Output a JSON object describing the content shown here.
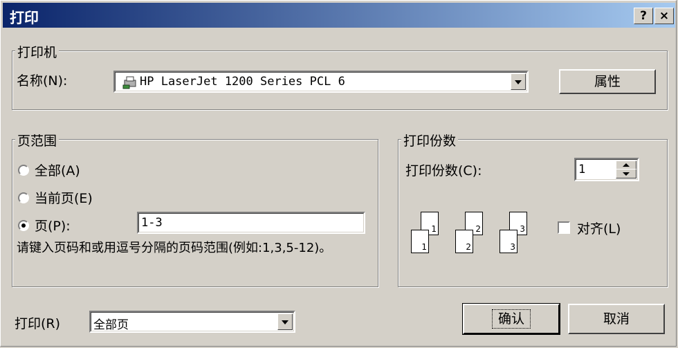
{
  "window": {
    "title": "打印",
    "help_btn": "?",
    "close_btn": "×"
  },
  "printer_group": {
    "legend": "打印机",
    "name_label": "名称(N):",
    "printer_name": "HP LaserJet 1200 Series PCL 6",
    "properties_button": "属性"
  },
  "range_group": {
    "legend": "页范围",
    "all_label": "全部(A)",
    "current_label": "当前页(E)",
    "pages_label": "页(P):",
    "pages_value": "1-3",
    "hint": "请键入页码和或用逗号分隔的页码范围(例如:1,3,5-12)。",
    "selected": "pages"
  },
  "copies_group": {
    "legend": "打印份数",
    "copies_label": "打印份数(C):",
    "copies_value": "1",
    "collate_label": "对齐(L)",
    "collate_checked": false,
    "page_numbers": [
      "1",
      "1",
      "2",
      "2",
      "3",
      "3"
    ]
  },
  "print_what": {
    "label": "打印(R)",
    "value": "全部页"
  },
  "buttons": {
    "ok": "确认",
    "cancel": "取消"
  }
}
